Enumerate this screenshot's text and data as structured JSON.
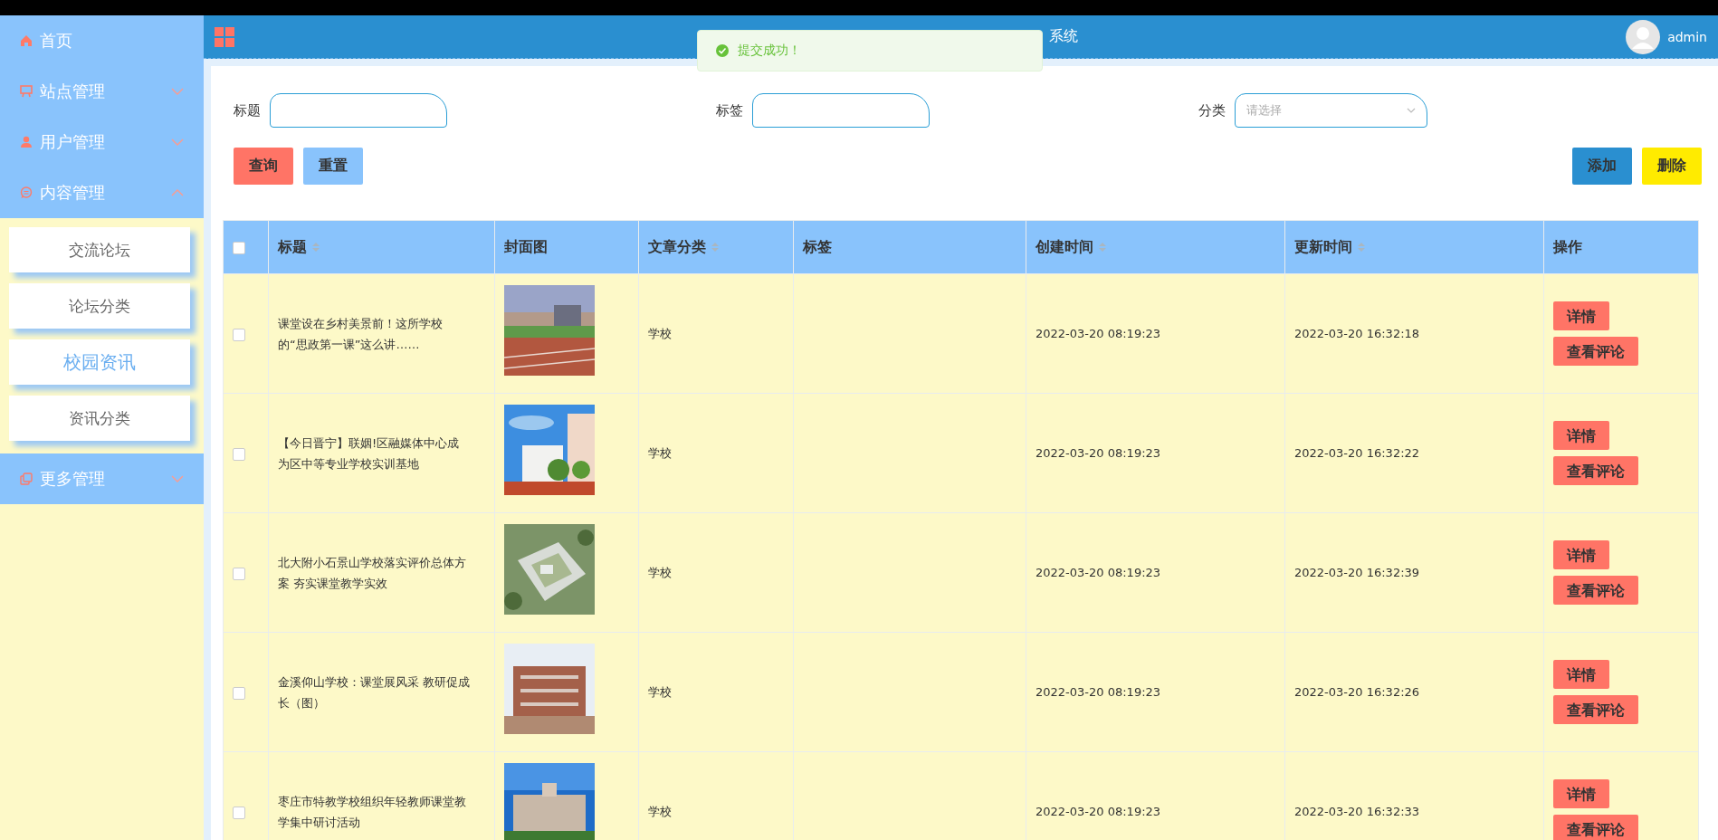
{
  "sidebar": {
    "items": [
      {
        "label": "首页"
      },
      {
        "label": "站点管理",
        "expanded": false
      },
      {
        "label": "用户管理",
        "expanded": false
      },
      {
        "label": "内容管理",
        "expanded": true,
        "children": [
          {
            "label": "交流论坛",
            "selected": false
          },
          {
            "label": "论坛分类",
            "selected": false
          },
          {
            "label": "校园资讯",
            "selected": true
          },
          {
            "label": "资讯分类",
            "selected": false
          }
        ]
      },
      {
        "label": "更多管理",
        "expanded": false
      }
    ]
  },
  "header": {
    "title": "系统",
    "user": "admin"
  },
  "toast": {
    "message": "提交成功！"
  },
  "filters": [
    {
      "label": "标题",
      "kind": "text"
    },
    {
      "label": "标签",
      "kind": "text"
    },
    {
      "label": "分类",
      "kind": "select",
      "placeholder": "请选择"
    }
  ],
  "buttons": [
    {
      "label": "查询",
      "kind": "query"
    },
    {
      "label": "重置",
      "kind": "reset"
    },
    {
      "label": "添加",
      "kind": "add"
    },
    {
      "label": "删除",
      "kind": "delete"
    }
  ],
  "table": {
    "select_all": {
      "checked": false
    },
    "columns": [
      {
        "label": "标题",
        "sortable": true
      },
      {
        "label": "封面图",
        "sortable": false
      },
      {
        "label": "文章分类",
        "sortable": true
      },
      {
        "label": "标签",
        "sortable": false
      },
      {
        "label": "创建时间",
        "sortable": true
      },
      {
        "label": "更新时间",
        "sortable": true
      },
      {
        "label": "操作",
        "sortable": false
      }
    ],
    "rows": [
      {
        "checked": false,
        "title": "课堂设在乡村美景前！这所学校的“思政第一课”这么讲……",
        "cover": {
          "kind": "picture"
        },
        "category": "学校",
        "created": "2022-03-20 08:19:23",
        "updated": "2022-03-20 16:32:18",
        "actions": [
          "详情",
          "查看评论"
        ]
      },
      {
        "checked": false,
        "title": "【今日晋宁】联姻!区融媒体中心成为区中等专业学校实训基地",
        "cover": {
          "kind": "picture"
        },
        "category": "学校",
        "created": "2022-03-20 08:19:23",
        "updated": "2022-03-20 16:32:22",
        "actions": [
          "详情",
          "查看评论"
        ]
      },
      {
        "checked": false,
        "title": "北大附小石景山学校落实评价总体方案 夯实课堂教学实效",
        "cover": {
          "kind": "picture"
        },
        "category": "学校",
        "created": "2022-03-20 08:19:23",
        "updated": "2022-03-20 16:32:39",
        "actions": [
          "详情",
          "查看评论"
        ]
      },
      {
        "checked": false,
        "title": "金溪仰山学校：课堂展风采 教研促成长（图）",
        "cover": {
          "kind": "picture"
        },
        "category": "学校",
        "created": "2022-03-20 08:19:23",
        "updated": "2022-03-20 16:32:26",
        "actions": [
          "详情",
          "查看评论"
        ]
      },
      {
        "checked": false,
        "title": "枣庄市特教学校组织年轻教师课堂教学集中研讨活动",
        "cover": {
          "kind": "picture"
        },
        "category": "学校",
        "created": "2022-03-20 08:19:23",
        "updated": "2022-03-20 16:32:33",
        "actions": [
          "详情",
          "查看评论"
        ]
      }
    ]
  }
}
